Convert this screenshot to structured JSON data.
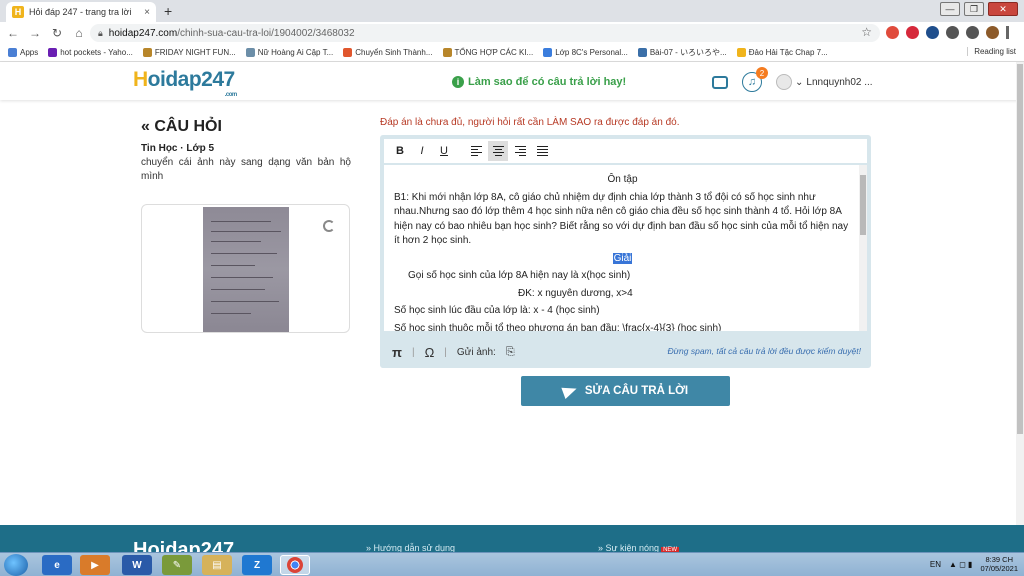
{
  "browser": {
    "tab_title": "Hỏi đáp 247 - trang tra lời",
    "tab_close": "×",
    "new_tab": "+",
    "url_host": "hoidap247.com",
    "url_path": "/chinh-sua-cau-tra-loi/1904002/3468032",
    "bookmarks": [
      "Apps",
      "hot pockets - Yaho...",
      "FRIDAY NIGHT FUN...",
      "Nữ Hoàng Ai Cập T...",
      "Chuyển Sinh Thành...",
      "TỔNG HỢP CÁC KI...",
      "Lớp 8C's Personal...",
      "Bài-07 - いろいろや...",
      "Đảo Hải Tặc Chap 7..."
    ],
    "reading_list": "Reading list"
  },
  "header": {
    "logo_h": "H",
    "logo_rest": "oidap247",
    "logo_sub": ".com",
    "hint": "Làm sao để có câu trả lời hay!",
    "notif_count": "2",
    "username": "Lnnquynh02 ..."
  },
  "question": {
    "heading": "« CÂU HỎI",
    "meta": "Tin Học · Lớp 5",
    "text": "chuyển cái ảnh này sang dạng văn bản hộ mình"
  },
  "answer": {
    "warning": "Đáp án là chưa đủ, người hỏi rất cần LÀM SAO ra được đáp án đó.",
    "toolbar": {
      "bold": "B",
      "italic": "I",
      "underline": "U"
    },
    "title": "Ôn tập",
    "problem": "B1: Khi mới nhận lớp 8A, cô giáo chủ nhiệm dự định chia lớp thành 3 tổ đội có số học sinh như nhau.Nhưng sao đó lớp thêm 4 học sinh nữa nên cô giáo chia đều số học sinh thành 4 tổ. Hỏi lớp 8A hiện nay có bao nhiêu bạn học sinh? Biết rằng so với dự định ban đầu số học sinh của mỗi tổ hiện nay ít hơn 2 học sinh.",
    "solution_label": "Giải",
    "line1": "Gọi số học sinh của lớp 8A hiện nay là x(học sinh)",
    "line2": "ĐK: x nguyên dương, x>4",
    "line3": "Số học sinh lúc đầu của lớp là: x - 4 (học sinh)",
    "line4": "Số học sinh thuộc mỗi tổ theo phương án ban đầu: \\frac{x-4}{3} (học sinh)",
    "footer_pi": "π",
    "footer_omega": "Ω",
    "attach_label": "Gửi ảnh:",
    "spam_note": "Đừng spam, tất cả câu trả lời đều được kiểm duyệt!",
    "submit": "SỬA CÂU TRẢ LỜI"
  },
  "footer": {
    "logo": "Hoidap247",
    "link1": "» Hướng dẫn sử dụng",
    "link2": "» Sự kiện nóng",
    "new": "NEW"
  },
  "taskbar": {
    "lang": "EN",
    "time": "8:39 CH",
    "date": "07/05/2021"
  },
  "colors": {
    "brand": "#2d7a9c",
    "accent": "#f0b41c",
    "hint_green": "#3aa04a",
    "warning_red": "#b73a25",
    "button": "#3f87a6",
    "footer": "#1e6e88"
  }
}
